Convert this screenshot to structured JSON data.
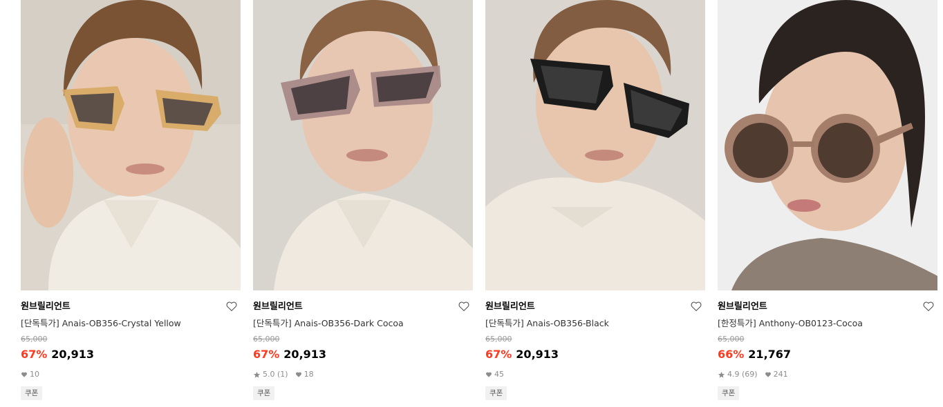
{
  "products": [
    {
      "brand": "원브릴리언트",
      "title": "[단독특가] Anais-OB356-Crystal Yellow",
      "original_price": "65,000",
      "discount_rate": "67%",
      "price": "20,913",
      "rating": "",
      "reviews": "",
      "likes": "10",
      "coupon_label": "쿠폰",
      "frame_color": "#d8a862"
    },
    {
      "brand": "원브릴리언트",
      "title": "[단독특가] Anais-OB356-Dark Cocoa",
      "original_price": "65,000",
      "discount_rate": "67%",
      "price": "20,913",
      "rating": "5.0",
      "reviews": "(1)",
      "likes": "18",
      "coupon_label": "쿠폰",
      "frame_color": "#a98a88"
    },
    {
      "brand": "원브릴리언트",
      "title": "[단독특가] Anais-OB356-Black",
      "original_price": "65,000",
      "discount_rate": "67%",
      "price": "20,913",
      "rating": "",
      "reviews": "",
      "likes": "45",
      "coupon_label": "쿠폰",
      "frame_color": "#1b1b1b"
    },
    {
      "brand": "원브릴리언트",
      "title": "[한정특가] Anthony-OB0123-Cocoa",
      "original_price": "65,000",
      "discount_rate": "66%",
      "price": "21,767",
      "rating": "4.9",
      "reviews": "(69)",
      "likes": "241",
      "coupon_label": "쿠폰",
      "frame_color": "#a07a66"
    }
  ],
  "colors": {
    "discount": "#ff3a1f",
    "strike": "#9a9a9a",
    "meta": "#8c8c8c",
    "coupon_bg": "#f1f1f1"
  },
  "icons": {
    "wishlist": "heart-outline-icon",
    "star": "star-icon",
    "like": "heart-filled-icon"
  }
}
